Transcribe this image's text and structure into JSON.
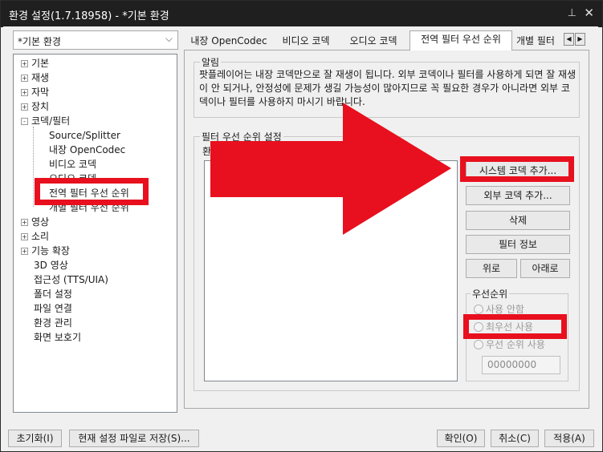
{
  "window": {
    "title": "환경 설정(1.7.18958) - *기본 환경",
    "pin_glyph": "⊥",
    "close_glyph": "✕"
  },
  "profile_select": {
    "value": "*기본 환경",
    "chevron": "⌵"
  },
  "tree": {
    "items": [
      {
        "label": "기본",
        "expander": "+"
      },
      {
        "label": "재생",
        "expander": "+"
      },
      {
        "label": "자막",
        "expander": "+"
      },
      {
        "label": "장치",
        "expander": "+"
      },
      {
        "label": "코덱/필터",
        "expander": "-"
      },
      {
        "label": "Source/Splitter"
      },
      {
        "label": "내장 OpenCodec"
      },
      {
        "label": "비디오 코덱"
      },
      {
        "label": "오디오 코덱"
      },
      {
        "label": "전역 필터 우선 순위"
      },
      {
        "label": "개별 필터 우선 순위"
      },
      {
        "label": "영상",
        "expander": "+"
      },
      {
        "label": "소리",
        "expander": "+"
      },
      {
        "label": "기능 확장",
        "expander": "+"
      },
      {
        "label": "3D 영상"
      },
      {
        "label": "접근성 (TTS/UIA)"
      },
      {
        "label": "폴더 설정"
      },
      {
        "label": "파일 연결"
      },
      {
        "label": "환경 관리"
      },
      {
        "label": "화면 보호기"
      }
    ]
  },
  "tabs": [
    {
      "label": "내장 OpenCodec"
    },
    {
      "label": "비디오 코덱"
    },
    {
      "label": "오디오 코덱"
    },
    {
      "label": "전역 필터 우선 순위",
      "active": true
    },
    {
      "label": "개별 필터"
    }
  ],
  "tab_scroll": {
    "left": "◀",
    "right": "▶"
  },
  "notice": {
    "title": "알림",
    "text": "팟플레이어는 내장 코덱만으로 잘 재생이 됩니다. 외부 코덱이나 필터를 사용하게 되면 잘 재생이 안 되거나, 안정성에 문제가 생길 가능성이 많아지므로 꼭 필요한 경우가 아니라면 외부 코덱이나 필터를 사용하지 마시기 바랍니다."
  },
  "filter_group": {
    "title": "필터 우선 순위 설정",
    "sub_label": "환",
    "list_items": [],
    "buttons": {
      "add_system_codec": "시스템 코덱 추가...",
      "add_external_codec": "외부 코덱 추가...",
      "delete": "삭제",
      "filter_info": "필터 정보",
      "up": "위로",
      "down": "아래로"
    }
  },
  "priority_group": {
    "title": "우선순위",
    "options": [
      {
        "label": "사용 안함"
      },
      {
        "label": "최우선 사용"
      },
      {
        "label": "우선 순위 사용"
      }
    ],
    "input_value": "00000000"
  },
  "footer": {
    "reset": "초기화(I)",
    "save_to_file": "현재 설정 파일로 저장(S)...",
    "ok": "확인(O)",
    "cancel": "취소(C)",
    "apply": "적용(A)"
  },
  "annotations": {
    "highlight_color": "#e8101e"
  }
}
